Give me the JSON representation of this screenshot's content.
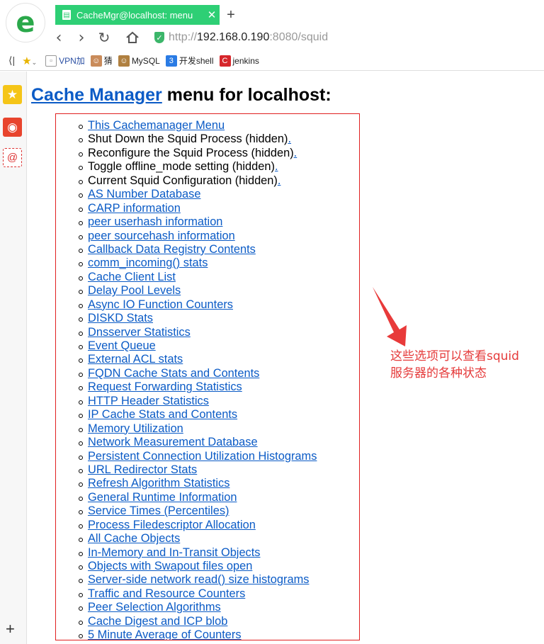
{
  "browser": {
    "logo_letter": "e",
    "tab_title": "CacheMgr@localhost: menu",
    "tab_close": "✕",
    "new_tab": "+",
    "url_proto": "http://",
    "url_host": "192.168.0.190",
    "url_port": ":8080",
    "url_path": "/squid"
  },
  "bookmarks": [
    {
      "label": "VPN加",
      "icon": "page-icon",
      "color": "#888888"
    },
    {
      "label": "猜",
      "icon": "avatar-icon",
      "color": "#c98b5a"
    },
    {
      "label": "MySQL",
      "icon": "avatar-icon",
      "color": "#b08040"
    },
    {
      "label": "开发shell",
      "icon": "app-icon",
      "color": "#2a7be4"
    },
    {
      "label": "jenkins",
      "icon": "jenkins-icon",
      "color": "#d6262b"
    }
  ],
  "page": {
    "heading_link": "Cache Manager",
    "heading_rest": " menu for localhost:"
  },
  "menu": [
    {
      "text": "This Cachemanager Menu",
      "link": true
    },
    {
      "text": "Shut Down the Squid Process (hidden)",
      "link": false,
      "tail": "."
    },
    {
      "text": "Reconfigure the Squid Process (hidden)",
      "link": false,
      "tail": "."
    },
    {
      "text": "Toggle offline_mode setting (hidden)",
      "link": false,
      "tail": "."
    },
    {
      "text": "Current Squid Configuration (hidden)",
      "link": false,
      "tail": "."
    },
    {
      "text": "AS Number Database",
      "link": true
    },
    {
      "text": "CARP information",
      "link": true
    },
    {
      "text": "peer userhash information",
      "link": true
    },
    {
      "text": "peer sourcehash information",
      "link": true
    },
    {
      "text": "Callback Data Registry Contents",
      "link": true
    },
    {
      "text": "comm_incoming() stats",
      "link": true
    },
    {
      "text": "Cache Client List",
      "link": true
    },
    {
      "text": "Delay Pool Levels",
      "link": true
    },
    {
      "text": "Async IO Function Counters",
      "link": true
    },
    {
      "text": "DISKD Stats",
      "link": true
    },
    {
      "text": "Dnsserver Statistics",
      "link": true
    },
    {
      "text": "Event Queue",
      "link": true
    },
    {
      "text": "External ACL stats",
      "link": true
    },
    {
      "text": "FQDN Cache Stats and Contents",
      "link": true
    },
    {
      "text": "Request Forwarding Statistics",
      "link": true
    },
    {
      "text": "HTTP Header Statistics",
      "link": true
    },
    {
      "text": "IP Cache Stats and Contents",
      "link": true
    },
    {
      "text": "Memory Utilization",
      "link": true
    },
    {
      "text": "Network Measurement Database",
      "link": true
    },
    {
      "text": "Persistent Connection Utilization Histograms",
      "link": true
    },
    {
      "text": "URL Redirector Stats",
      "link": true
    },
    {
      "text": "Refresh Algorithm Statistics",
      "link": true
    },
    {
      "text": "General Runtime Information",
      "link": true
    },
    {
      "text": "Service Times (Percentiles)",
      "link": true
    },
    {
      "text": "Process Filedescriptor Allocation",
      "link": true
    },
    {
      "text": "All Cache Objects",
      "link": true
    },
    {
      "text": "In-Memory and In-Transit Objects",
      "link": true
    },
    {
      "text": "Objects with Swapout files open",
      "link": true
    },
    {
      "text": "Server-side network read() size histograms",
      "link": true
    },
    {
      "text": "Traffic and Resource Counters",
      "link": true
    },
    {
      "text": "Peer Selection Algorithms",
      "link": true
    },
    {
      "text": "Cache Digest and ICP blob",
      "link": true
    },
    {
      "text": "5 Minute Average of Counters",
      "link": true
    }
  ],
  "annotation": {
    "line1": "这些选项可以查看squid",
    "line2": "服务器的各种状态",
    "color": "#e53a3a"
  },
  "colors": {
    "tab_green": "#2ecf75",
    "link_blue": "#0b5bc6",
    "box_red": "#e02020"
  }
}
